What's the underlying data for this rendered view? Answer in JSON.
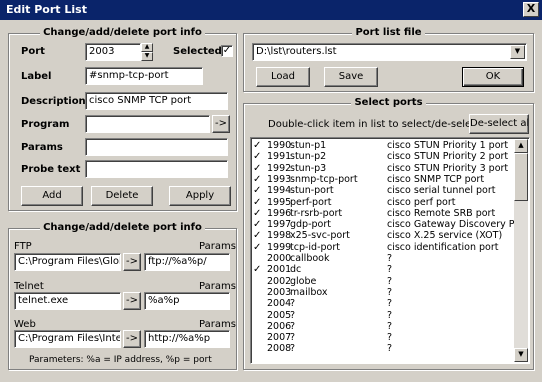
{
  "window": {
    "title": "Edit Port List",
    "close": "X"
  },
  "port_info": {
    "title": "Change/add/delete port info",
    "port_label": "Port",
    "port_value": "2003",
    "selected_label": "Selected",
    "selected_check": "✓",
    "label_label": "Label",
    "label_value": "#snmp-tcp-port",
    "description_label": "Description",
    "description_value": "cisco SNMP TCP port",
    "program_label": "Program",
    "program_value": "",
    "program_browse": "->",
    "params_label": "Params",
    "params_value": "",
    "probe_label": "Probe text",
    "probe_value": "",
    "add": "Add",
    "delete": "Delete",
    "apply": "Apply"
  },
  "program_info": {
    "title": "Change/add/delete port info",
    "ftp_label": "FTP",
    "ftp_params_label": "Params",
    "ftp_path": "C:\\Program Files\\Global",
    "ftp_browse": "->",
    "ftp_params": "ftp://%a%p/",
    "telnet_label": "Telnet",
    "telnet_params_label": "Params",
    "telnet_path": "telnet.exe",
    "telnet_browse": "->",
    "telnet_params": "%a%p",
    "web_label": "Web",
    "web_params_label": "Params",
    "web_path": "C:\\Program Files\\Intern",
    "web_browse": "->",
    "web_params": "http://%a%p",
    "footer": "Parameters: %a = IP address, %p = port"
  },
  "port_list_file": {
    "title": "Port list file",
    "path": "D:\\lst\\routers.lst",
    "load": "Load",
    "save": "Save",
    "ok": "OK"
  },
  "select_ports": {
    "title": "Select ports",
    "hint": "Double-click item in list to select/de-select",
    "deselect_all": "De-select all",
    "rows": [
      {
        "check": "✓",
        "num": "1990",
        "name": "stun-p1",
        "desc": "cisco STUN Priority 1 port"
      },
      {
        "check": "✓",
        "num": "1991",
        "name": "stun-p2",
        "desc": "cisco STUN Priority 2 port"
      },
      {
        "check": "✓",
        "num": "1992",
        "name": "stun-p3",
        "desc": "cisco STUN Priority 3 port"
      },
      {
        "check": "✓",
        "num": "1993",
        "name": "snmp-tcp-port",
        "desc": "cisco SNMP TCP port"
      },
      {
        "check": "✓",
        "num": "1994",
        "name": "stun-port",
        "desc": "cisco serial tunnel port"
      },
      {
        "check": "✓",
        "num": "1995",
        "name": "perf-port",
        "desc": "cisco perf port"
      },
      {
        "check": "✓",
        "num": "1996",
        "name": "tr-rsrb-port",
        "desc": "cisco Remote SRB port"
      },
      {
        "check": "✓",
        "num": "1997",
        "name": "gdp-port",
        "desc": "cisco Gateway Discovery Port"
      },
      {
        "check": "✓",
        "num": "1998",
        "name": "x25-svc-port",
        "desc": "cisco X.25 service (XOT)"
      },
      {
        "check": "✓",
        "num": "1999",
        "name": "tcp-id-port",
        "desc": "cisco identification port"
      },
      {
        "check": "",
        "num": "2000",
        "name": "callbook",
        "desc": "?"
      },
      {
        "check": "✓",
        "num": "2001",
        "name": "dc",
        "desc": "?"
      },
      {
        "check": "",
        "num": "2002",
        "name": "globe",
        "desc": "?"
      },
      {
        "check": "",
        "num": "2003",
        "name": "mailbox",
        "desc": "?"
      },
      {
        "check": "",
        "num": "2004",
        "name": "?",
        "desc": "?"
      },
      {
        "check": "",
        "num": "2005",
        "name": "?",
        "desc": "?"
      },
      {
        "check": "",
        "num": "2006",
        "name": "?",
        "desc": "?"
      },
      {
        "check": "",
        "num": "2007",
        "name": "?",
        "desc": "?"
      },
      {
        "check": "",
        "num": "2008",
        "name": "?",
        "desc": "?"
      }
    ]
  }
}
